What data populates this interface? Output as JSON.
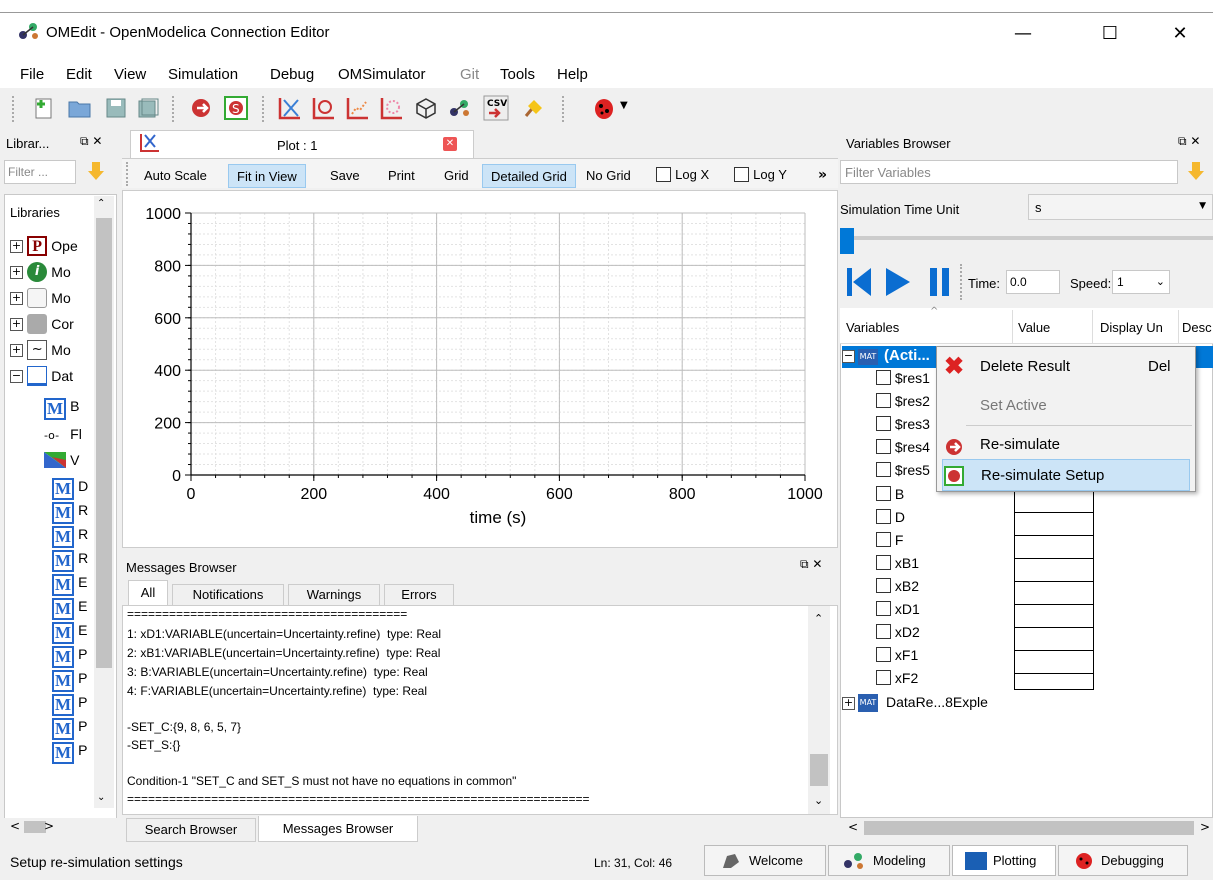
{
  "window": {
    "title": "OMEdit - OpenModelica Connection Editor",
    "minimize": "—",
    "maximize": "☐",
    "close": "✕"
  },
  "menu": [
    "File",
    "Edit",
    "View",
    "Simulation",
    "Debug",
    "OMSimulator",
    "Git",
    "Tools",
    "Help"
  ],
  "toolbar": {
    "icons": [
      "new-file-icon",
      "open-folder-icon",
      "save-icon",
      "save-all-icon",
      "simulate-icon",
      "simulation-setup-icon",
      "plot-icon",
      "parametric-plot-icon",
      "array-plot-icon",
      "array-parametric-plot-icon",
      "diagram-window-icon",
      "omsimulator-icon",
      "export-csv-icon",
      "clear-icon",
      "debugger-icon"
    ],
    "csv_label": "CSV"
  },
  "libraries": {
    "title": "Librar...",
    "filter_placeholder": "Filter ...",
    "tree_header": "Libraries",
    "items": [
      {
        "expander": "+",
        "icon": "P",
        "label": "Ope"
      },
      {
        "expander": "+",
        "icon": "i",
        "label": "Mo"
      },
      {
        "expander": "+",
        "icon": "",
        "label": "Mo"
      },
      {
        "expander": "+",
        "icon": "",
        "label": "Cor"
      },
      {
        "expander": "+",
        "icon": "~",
        "label": "Mo"
      },
      {
        "expander": "−",
        "icon": "",
        "label": "Dat"
      }
    ],
    "children": [
      {
        "icon": "M",
        "label": "B"
      },
      {
        "icon": "-o-",
        "label": "Fl"
      },
      {
        "icon": "",
        "label": "V"
      },
      {
        "icon": "M",
        "label": "D"
      },
      {
        "icon": "M",
        "label": "R"
      },
      {
        "icon": "M",
        "label": "R"
      },
      {
        "icon": "M",
        "label": "R"
      },
      {
        "icon": "M",
        "label": "E"
      },
      {
        "icon": "M",
        "label": "E"
      },
      {
        "icon": "M",
        "label": "E"
      },
      {
        "icon": "M",
        "label": "P"
      },
      {
        "icon": "M",
        "label": "P"
      },
      {
        "icon": "M",
        "label": "P"
      },
      {
        "icon": "M",
        "label": "P"
      },
      {
        "icon": "M",
        "label": "P"
      }
    ]
  },
  "plot": {
    "tab_label": "Plot : 1",
    "buttons": [
      "Auto Scale",
      "Fit in View",
      "Save",
      "Print",
      "Grid",
      "Detailed Grid",
      "No Grid"
    ],
    "log_x": "Log X",
    "log_y": "Log Y",
    "more": "»"
  },
  "chart_data": {
    "type": "line",
    "series": [],
    "xlabel": "time (s)",
    "ylabel": "",
    "xlim": [
      0,
      1000
    ],
    "ylim": [
      0,
      1000
    ],
    "x_ticks": [
      "0",
      "200",
      "400",
      "600",
      "800",
      "1000"
    ],
    "y_ticks": [
      "0",
      "200",
      "400",
      "600",
      "800",
      "1000"
    ],
    "grid": "detailed"
  },
  "messages": {
    "title": "Messages Browser",
    "tabs": [
      "All",
      "Notifications",
      "Warnings",
      "Errors"
    ],
    "lines": [
      "========================================",
      "1: xD1:VARIABLE(uncertain=Uncertainty.refine)  type: Real",
      "2: xB1:VARIABLE(uncertain=Uncertainty.refine)  type: Real",
      "3: B:VARIABLE(uncertain=Uncertainty.refine)  type: Real",
      "4: F:VARIABLE(uncertain=Uncertainty.refine)  type: Real",
      "",
      "-SET_C:{9, 8, 6, 5, 7}",
      "-SET_S:{}",
      "",
      "Condition-1 \"SET_C and SET_S must not have no equations in common\"",
      "=================================================================="
    ],
    "bottom_tabs": [
      "Search Browser",
      "Messages Browser"
    ]
  },
  "variables": {
    "title": "Variables Browser",
    "filter_placeholder": "Filter Variables",
    "time_unit_label": "Simulation Time Unit",
    "time_unit_value": "s",
    "time_label": "Time:",
    "time_value": "0.0",
    "speed_label": "Speed:",
    "speed_value": "1",
    "columns": [
      "Variables",
      "Value",
      "Display Un",
      "Desc"
    ],
    "root_label": "(Acti...",
    "root_badge": "MAT",
    "items": [
      "$res1",
      "$res2",
      "$res3",
      "$res4",
      "$res5",
      "B",
      "D",
      "F",
      "xB1",
      "xB2",
      "xD1",
      "xD2",
      "xF1",
      "xF2"
    ],
    "second_result": "DataRe...8Exple"
  },
  "context_menu": {
    "items": [
      {
        "label": "Delete Result",
        "shortcut": "Del",
        "icon": "delete-icon",
        "enabled": true
      },
      {
        "label": "Set Active",
        "shortcut": "",
        "icon": "",
        "enabled": false
      },
      {
        "label": "Re-simulate",
        "shortcut": "",
        "icon": "resimulate-icon",
        "enabled": true
      },
      {
        "label": "Re-simulate Setup",
        "shortcut": "",
        "icon": "resimulate-setup-icon",
        "enabled": true
      }
    ]
  },
  "statusbar": {
    "message": "Setup re-simulation settings",
    "position": "Ln: 31, Col: 46",
    "perspectives": [
      "Welcome",
      "Modeling",
      "Plotting",
      "Debugging"
    ]
  },
  "colors": {
    "accent": "#0078d7",
    "selection": "#cce4f7",
    "debug_red": "#cc2222"
  }
}
